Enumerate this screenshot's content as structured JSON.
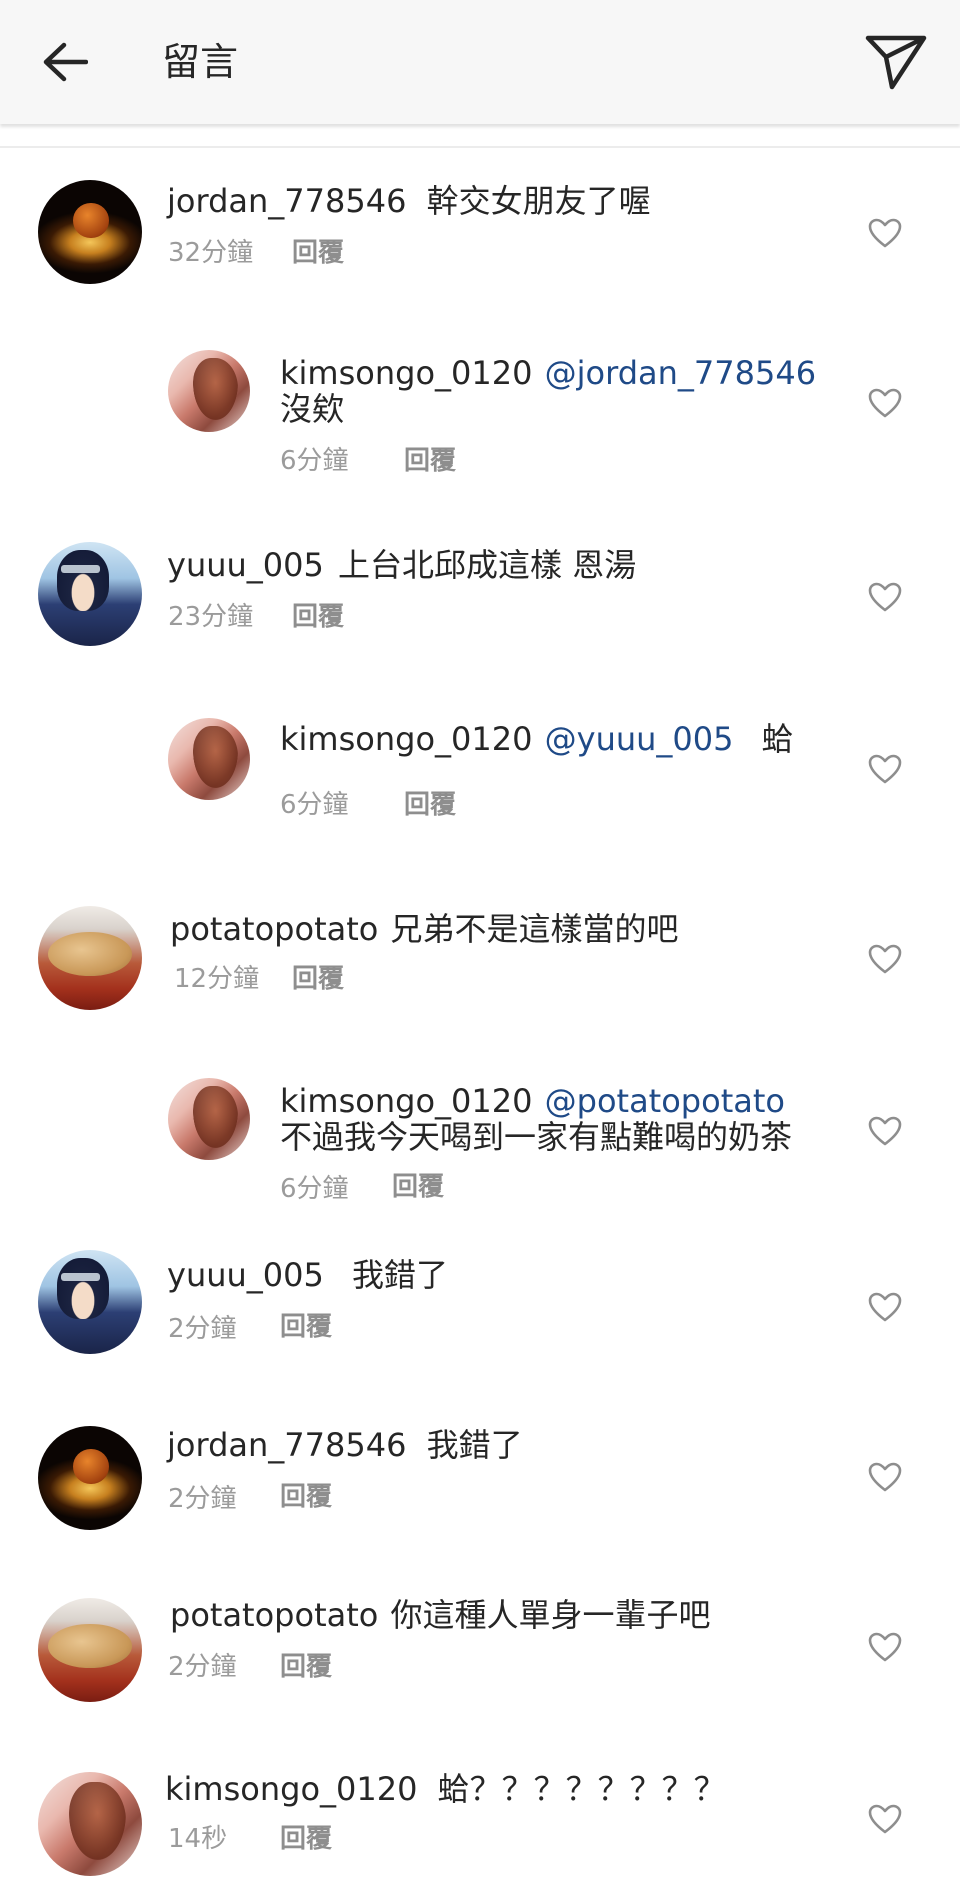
{
  "header": {
    "title": "留言"
  },
  "reply_label": "回覆",
  "comments": [
    {
      "username": "jordan_778546",
      "mention": "",
      "text": "幹交女朋友了喔",
      "line2": "",
      "time": "32分鐘",
      "avatar": "basketball-avatar"
    },
    {
      "username": "kimsongo_0120",
      "mention": "@jordan_778546",
      "text": "",
      "line2": "沒欸",
      "time": "6分鐘",
      "avatar": "kim-avatar"
    },
    {
      "username": "yuuu_005",
      "mention": "",
      "text": "上台北邱成這樣 恩湯",
      "line2": "",
      "time": "23分鐘",
      "avatar": "anime-avatar"
    },
    {
      "username": "kimsongo_0120",
      "mention": "@yuuu_005",
      "text": "蛤",
      "line2": "",
      "time": "6分鐘",
      "avatar": "kim-avatar"
    },
    {
      "username": "potatopotato",
      "mention": "",
      "text": "兄弟不是這樣當的吧",
      "line2": "",
      "time": "12分鐘",
      "avatar": "potato-avatar"
    },
    {
      "username": "kimsongo_0120",
      "mention": "@potatopotato",
      "text": "",
      "line2": "不過我今天喝到一家有點難喝的奶茶",
      "time": "6分鐘",
      "avatar": "kim-avatar"
    },
    {
      "username": "yuuu_005",
      "mention": "",
      "text": "我錯了",
      "line2": "",
      "time": "2分鐘",
      "avatar": "anime-avatar"
    },
    {
      "username": "jordan_778546",
      "mention": "",
      "text": "我錯了",
      "line2": "",
      "time": "2分鐘",
      "avatar": "basketball-avatar"
    },
    {
      "username": "potatopotato",
      "mention": "",
      "text": "你這種人單身一輩子吧",
      "line2": "",
      "time": "2分鐘",
      "avatar": "potato-avatar"
    },
    {
      "username": "kimsongo_0120",
      "mention": "",
      "text": "蛤？？？？？？？？",
      "line2": "",
      "time": "14秒",
      "avatar": "kim-avatar"
    }
  ],
  "colors": {
    "mention": "#1f4a87",
    "meta": "#9b9b9b",
    "text": "#262626"
  },
  "icons": {
    "back": "arrow-left-icon",
    "send": "paper-plane-icon",
    "like": "heart-outline-icon"
  }
}
